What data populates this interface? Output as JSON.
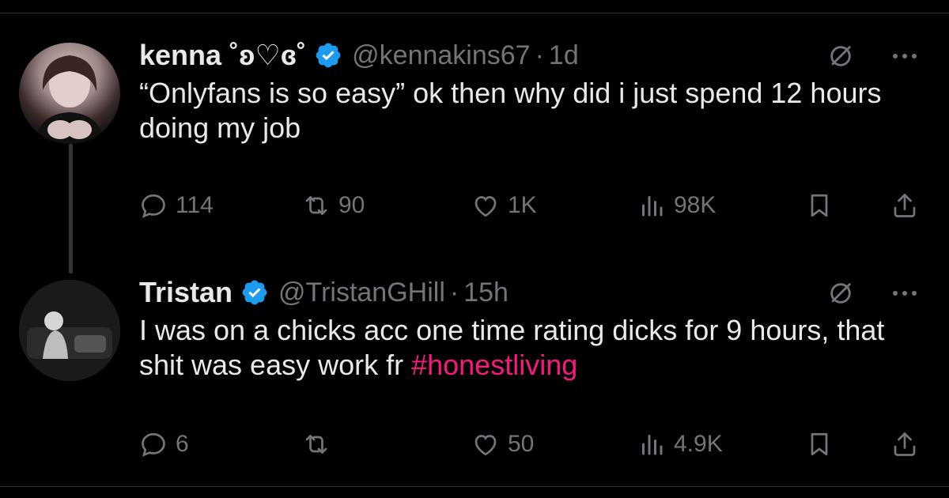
{
  "tweets": [
    {
      "name": "kenna ˚ʚ♡ɞ˚",
      "handle": "@kennakins67",
      "separator": "·",
      "time": "1d",
      "text": "“Onlyfans is so easy” ok then why did i just spend 12 hours doing my job",
      "hashtag": "",
      "reply_count": "114",
      "retweet_count": "90",
      "like_count": "1K",
      "views_count": "98K"
    },
    {
      "name": "Tristan",
      "handle": "@TristanGHill",
      "separator": "·",
      "time": "15h",
      "text": "I was on a chicks acc one time rating dicks for 9 hours, that shit was easy work fr ",
      "hashtag": "#honestliving",
      "reply_count": "6",
      "retweet_count": "",
      "like_count": "50",
      "views_count": "4.9K"
    }
  ],
  "icons": {
    "verified": "verified-badge-icon",
    "grok": "grok-icon",
    "more": "more-icon",
    "reply": "reply-icon",
    "retweet": "retweet-icon",
    "like": "heart-icon",
    "views": "views-icon",
    "bookmark": "bookmark-icon",
    "share": "share-icon"
  },
  "colors": {
    "background": "#000000",
    "text": "#e7e9ea",
    "secondary": "#71767b",
    "verified": "#1d9bf0",
    "hashtag": "#f91880",
    "divider": "#2f3336"
  }
}
